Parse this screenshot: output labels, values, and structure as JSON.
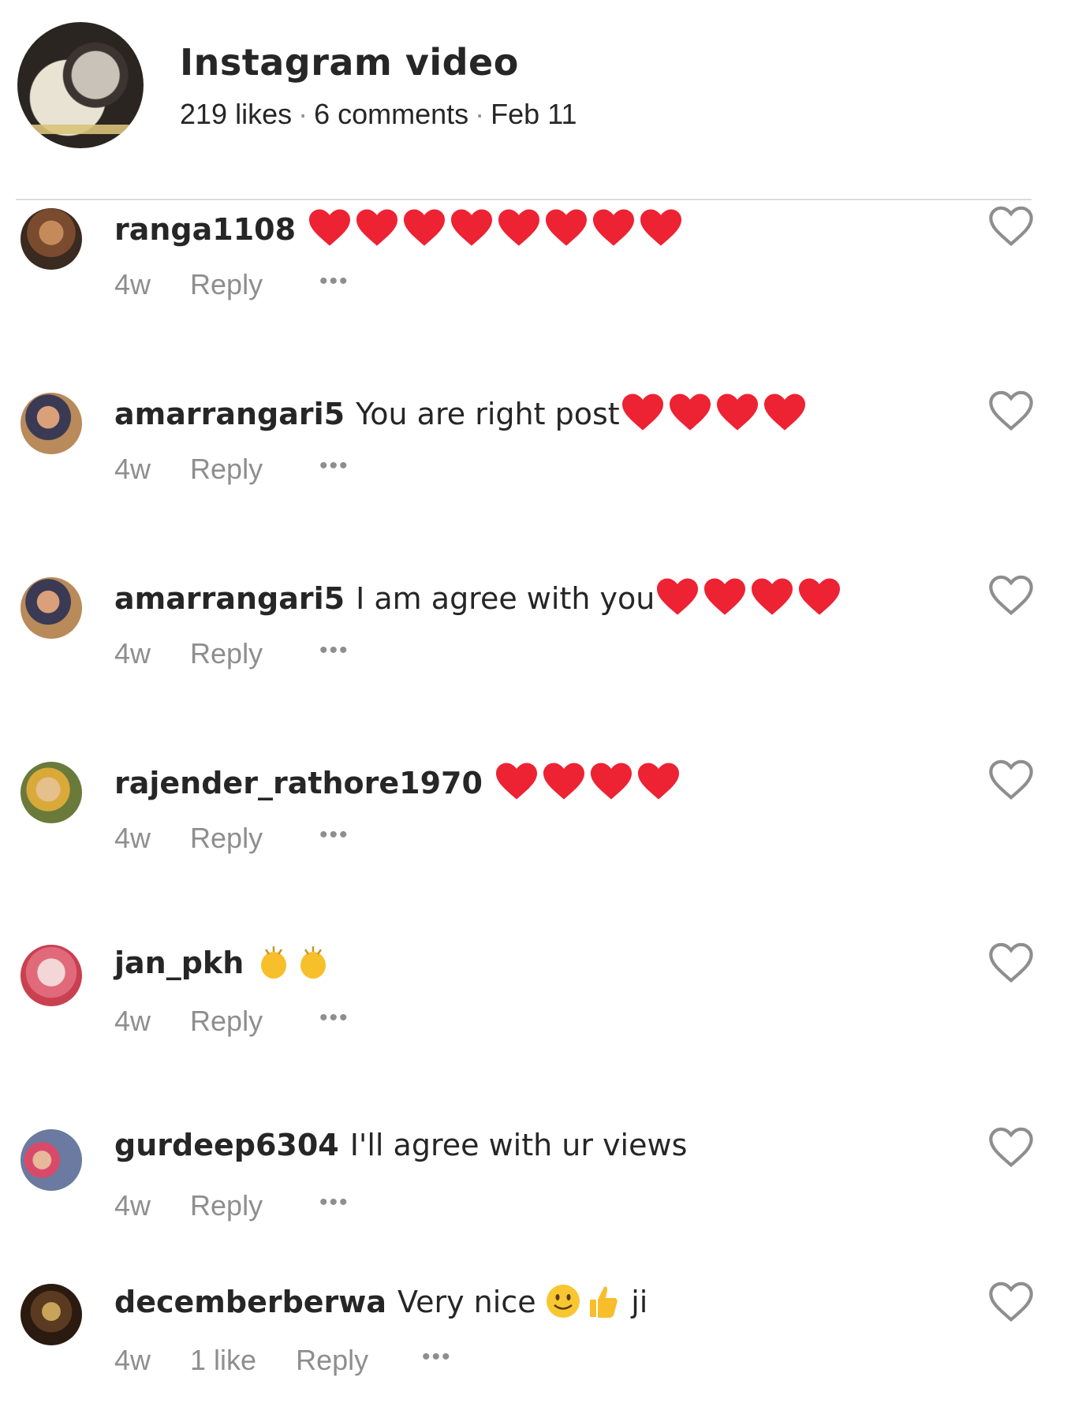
{
  "post": {
    "title": "Instagram video",
    "likes": "219 likes",
    "comments": "6 comments",
    "date": "Feb 11"
  },
  "colors": {
    "heart_red": "#ed2233",
    "meta_gray": "#8e8e8e",
    "text": "#262626"
  },
  "comments": [
    {
      "username": "ranga1108",
      "text": "",
      "emoji": [
        "heart",
        "heart",
        "heart",
        "heart",
        "heart",
        "heart",
        "heart",
        "heart"
      ],
      "age": "4w",
      "likes": "",
      "reply": "Reply"
    },
    {
      "username": "amarrangari5",
      "text": "You are right post",
      "emoji": [
        "heart",
        "heart",
        "heart",
        "heart"
      ],
      "age": "4w",
      "likes": "",
      "reply": "Reply"
    },
    {
      "username": "amarrangari5",
      "text": "I am agree with you",
      "emoji": [
        "heart",
        "heart",
        "heart",
        "heart"
      ],
      "age": "4w",
      "likes": "",
      "reply": "Reply"
    },
    {
      "username": "rajender_rathore1970",
      "text": "",
      "emoji": [
        "heart",
        "heart",
        "heart",
        "heart"
      ],
      "age": "4w",
      "likes": "",
      "reply": "Reply"
    },
    {
      "username": "jan_pkh",
      "text": "",
      "emoji": [
        "clap",
        "clap"
      ],
      "age": "4w",
      "likes": "",
      "reply": "Reply"
    },
    {
      "username": "gurdeep6304",
      "text": "I'll agree with ur views",
      "emoji": [],
      "age": "4w",
      "likes": "",
      "reply": "Reply"
    },
    {
      "username": "decemberberwa",
      "text": "Very nice",
      "emoji": [
        "smile",
        "thumbs-up"
      ],
      "text_after": "ji",
      "age": "4w",
      "likes": "1 like",
      "reply": "Reply"
    }
  ]
}
